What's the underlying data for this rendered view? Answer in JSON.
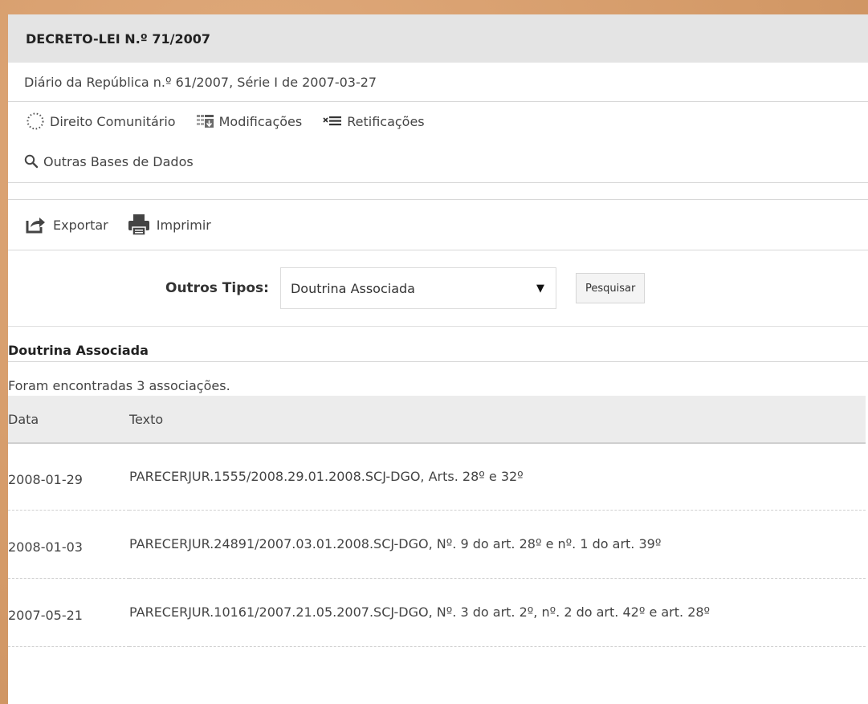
{
  "header": {
    "title": "DECRETO-LEI N.º 71/2007",
    "subtitle": "Diário da República n.º 61/2007, Série I de 2007-03-27"
  },
  "links": [
    {
      "label": "Direito Comunitário",
      "icon": "dotted-circle-icon"
    },
    {
      "label": "Modificações",
      "icon": "modifications-icon"
    },
    {
      "label": "Retificações",
      "icon": "rectifications-icon"
    },
    {
      "label": "Outras Bases de Dados",
      "icon": "search-icon"
    }
  ],
  "tools": {
    "export_label": "Exportar",
    "print_label": "Imprimir"
  },
  "search": {
    "label": "Outros Tipos:",
    "selected": "Doutrina Associada",
    "button_label": "Pesquisar"
  },
  "results": {
    "section_title": "Doutrina Associada",
    "count_text": "Foram encontradas 3 associações.",
    "columns": [
      "Data",
      "Texto"
    ],
    "rows": [
      {
        "date": "2008-01-29",
        "text": "PARECERJUR.1555/2008.29.01.2008.SCJ-DGO, Arts. 28º e 32º"
      },
      {
        "date": "2008-01-03",
        "text": "PARECERJUR.24891/2007.03.01.2008.SCJ-DGO, Nº. 9 do art. 28º e nº. 1 do art. 39º"
      },
      {
        "date": "2007-05-21",
        "text": "PARECERJUR.10161/2007.21.05.2007.SCJ-DGO, Nº. 3 do art. 2º, nº. 2 do art. 42º e art. 28º"
      }
    ]
  },
  "colors": {
    "background": "#d9a070",
    "title_bar": "#e4e4e4",
    "header_row": "#ececec"
  }
}
